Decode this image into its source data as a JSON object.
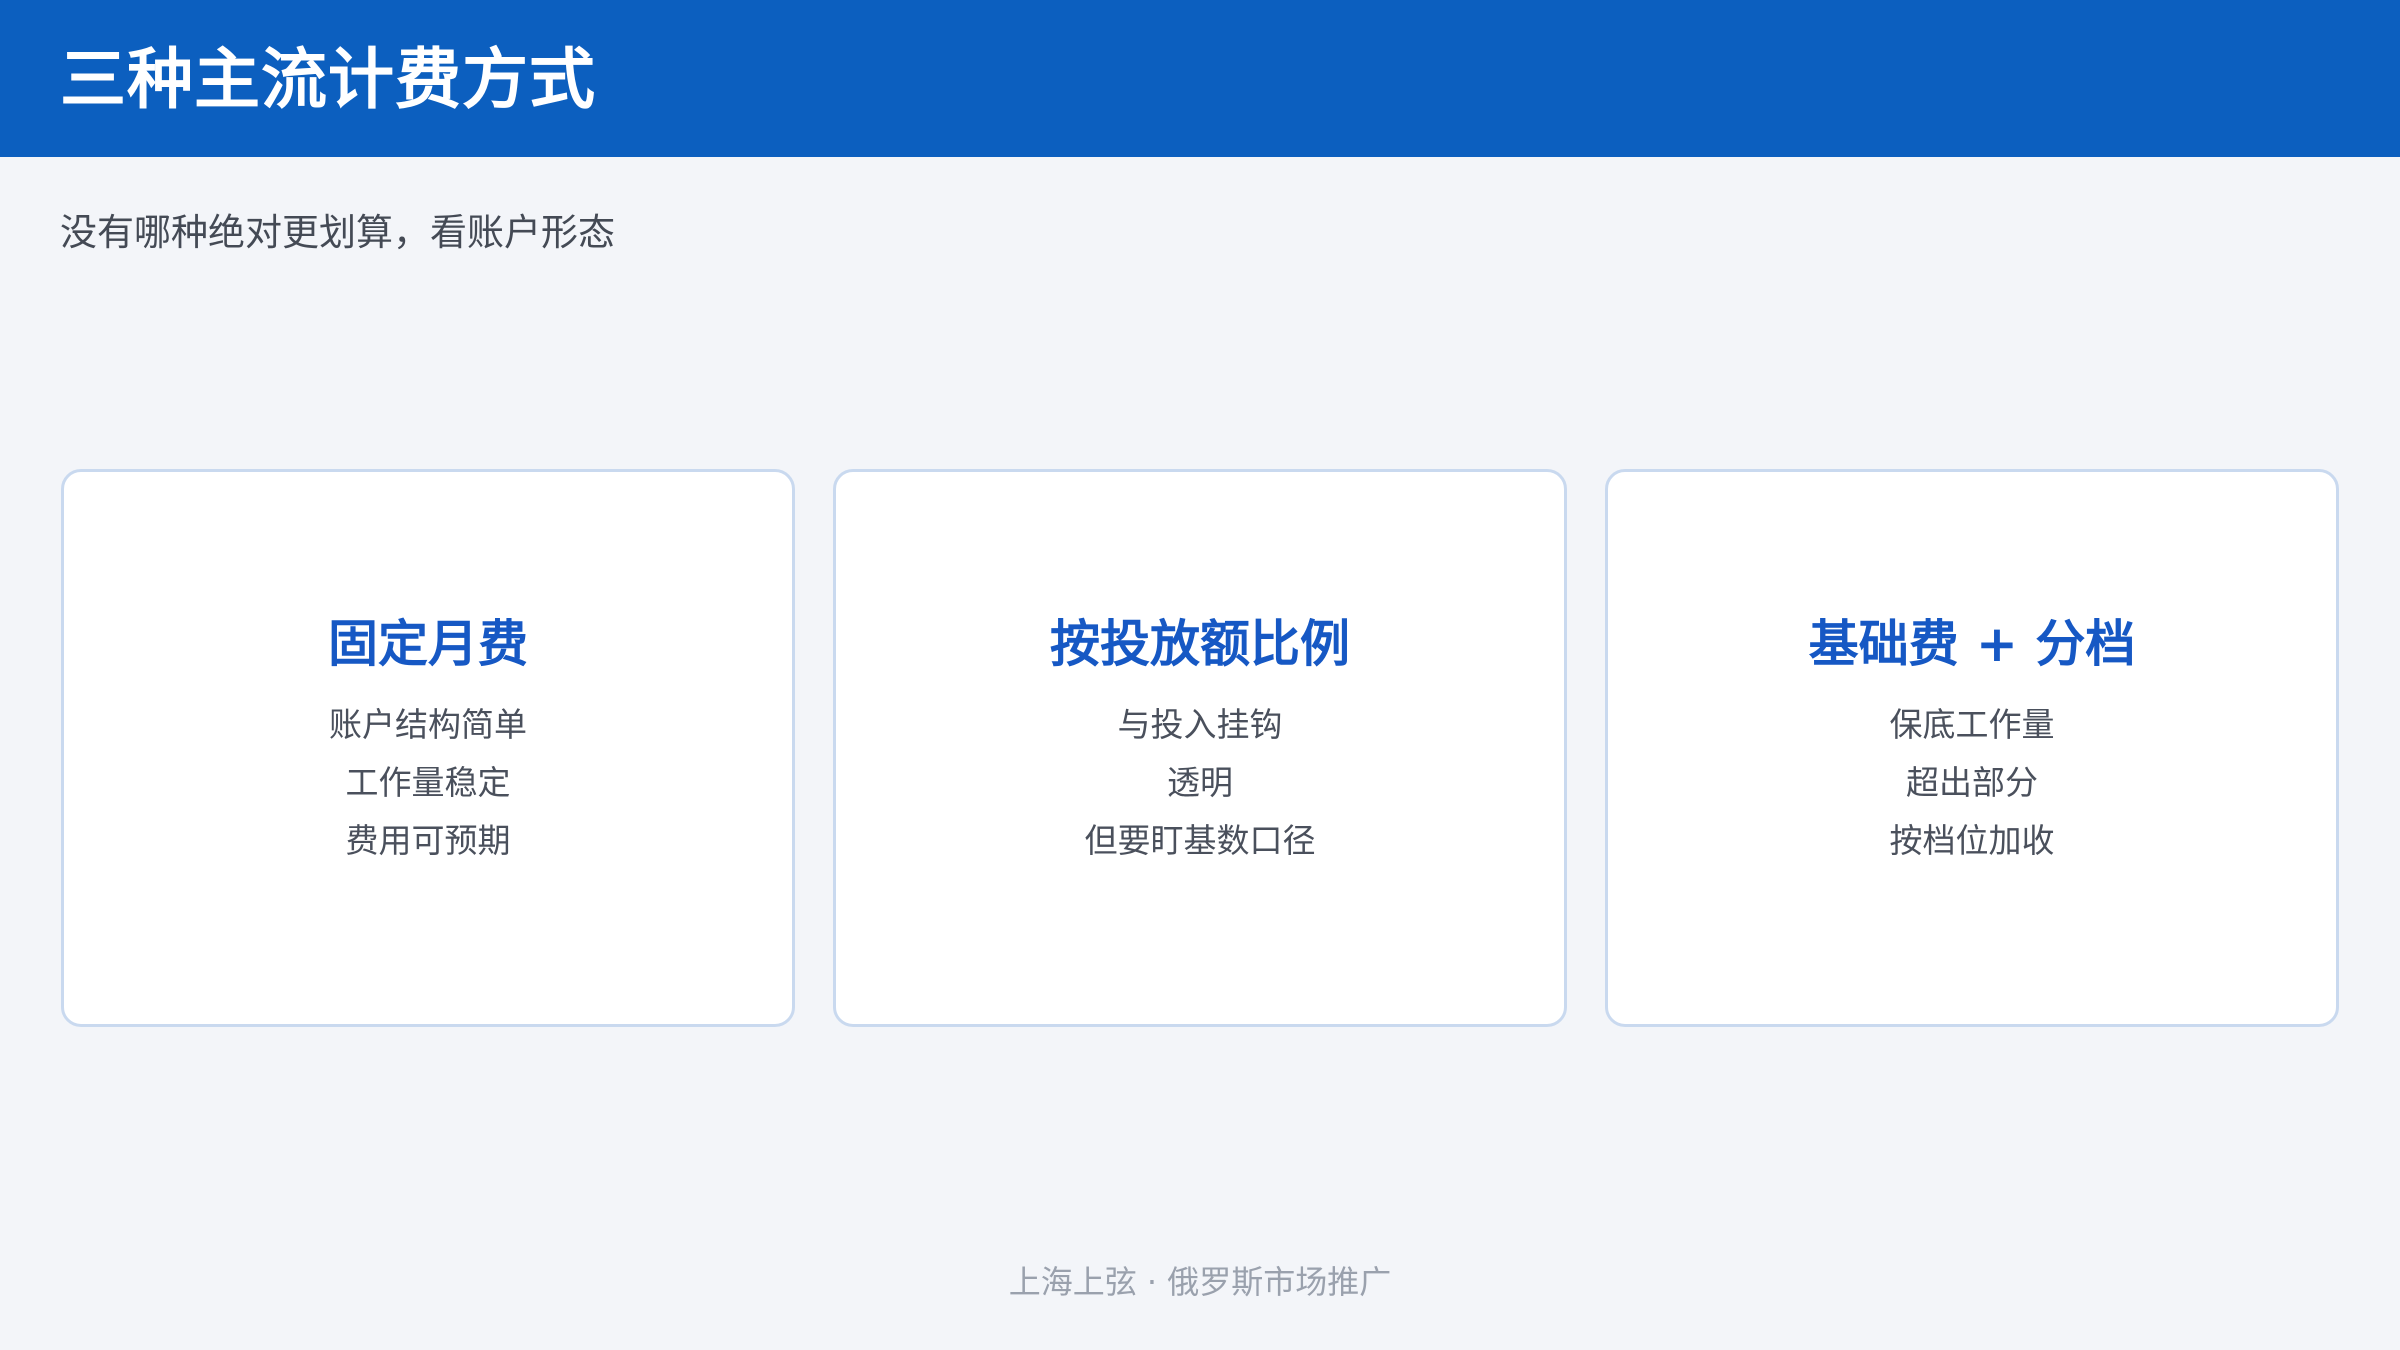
{
  "header": {
    "title": "三种主流计费方式"
  },
  "subtitle": "没有哪种绝对更划算，看账户形态",
  "cards": [
    {
      "title": "固定月费",
      "lines": [
        "账户结构简单",
        "工作量稳定",
        "费用可预期"
      ]
    },
    {
      "title": "按投放额比例",
      "lines": [
        "与投入挂钩",
        "透明",
        "但要盯基数口径"
      ]
    },
    {
      "title": "基础费 + 分档",
      "lines": [
        "保底工作量",
        "超出部分",
        "按档位加收"
      ]
    }
  ],
  "footer": "上海上弦 · 俄罗斯市场推广",
  "colors": {
    "header_bg": "#0c5fbf",
    "page_bg": "#f3f5f9",
    "card_title": "#1658c4",
    "card_border": "#c9d9ef"
  }
}
